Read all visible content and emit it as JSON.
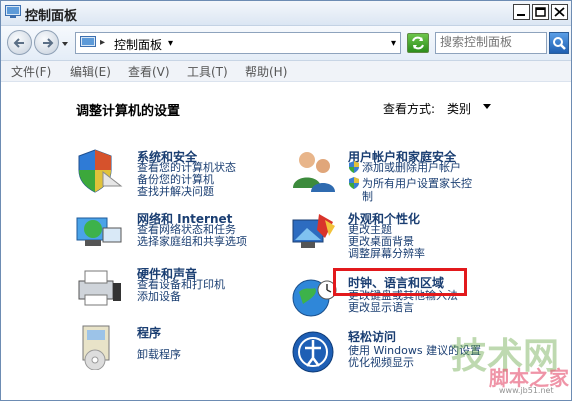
{
  "window": {
    "title": "控制面板",
    "controls": [
      "minimize-icon",
      "maximize-icon",
      "close-icon"
    ]
  },
  "address_bar": {
    "breadcrumb": "控制面板",
    "separator": "▸",
    "crumb_arrow": "▾",
    "dropdown_arrow": "▾",
    "search_placeholder": "搜索控制面板"
  },
  "menu": [
    "文件(F)",
    "编辑(E)",
    "查看(V)",
    "工具(T)",
    "帮助(H)"
  ],
  "content": {
    "heading": "调整计算机的设置",
    "view_by_label": "查看方式:",
    "view_by_value": "类别"
  },
  "categories": {
    "system_security": {
      "title": "系统和安全",
      "links": [
        "查看您的计算机状态",
        "备份您的计算机",
        "查找并解决问题"
      ]
    },
    "network": {
      "title": "网络和 Internet",
      "links": [
        "查看网络状态和任务",
        "选择家庭组和共享选项"
      ]
    },
    "hardware": {
      "title": "硬件和声音",
      "links": [
        "查看设备和打印机",
        "添加设备"
      ]
    },
    "programs": {
      "title": "程序",
      "links": [
        "卸载程序"
      ]
    },
    "user_accounts": {
      "title": "用户帐户和家庭安全",
      "links": [
        "添加或删除用户帐户",
        "为所有用户设置家长控",
        "制"
      ]
    },
    "appearance": {
      "title": "外观和个性化",
      "links": [
        "更改主题",
        "更改桌面背景",
        "调整屏幕分辨率"
      ]
    },
    "clock_region": {
      "title": "时钟、语言和区域",
      "links": [
        "更改键盘或其他输入法",
        "更改显示语言"
      ]
    },
    "ease_of_access": {
      "title": "轻松访问",
      "links": [
        "使用 Windows 建议的设置",
        "优化视频显示"
      ]
    }
  },
  "watermark": {
    "line1": "技术网",
    "line2": "脚本之家",
    "line3": "www.jb51.net"
  },
  "colors": {
    "link": "#1a3e72",
    "highlight": "#e2191c"
  }
}
